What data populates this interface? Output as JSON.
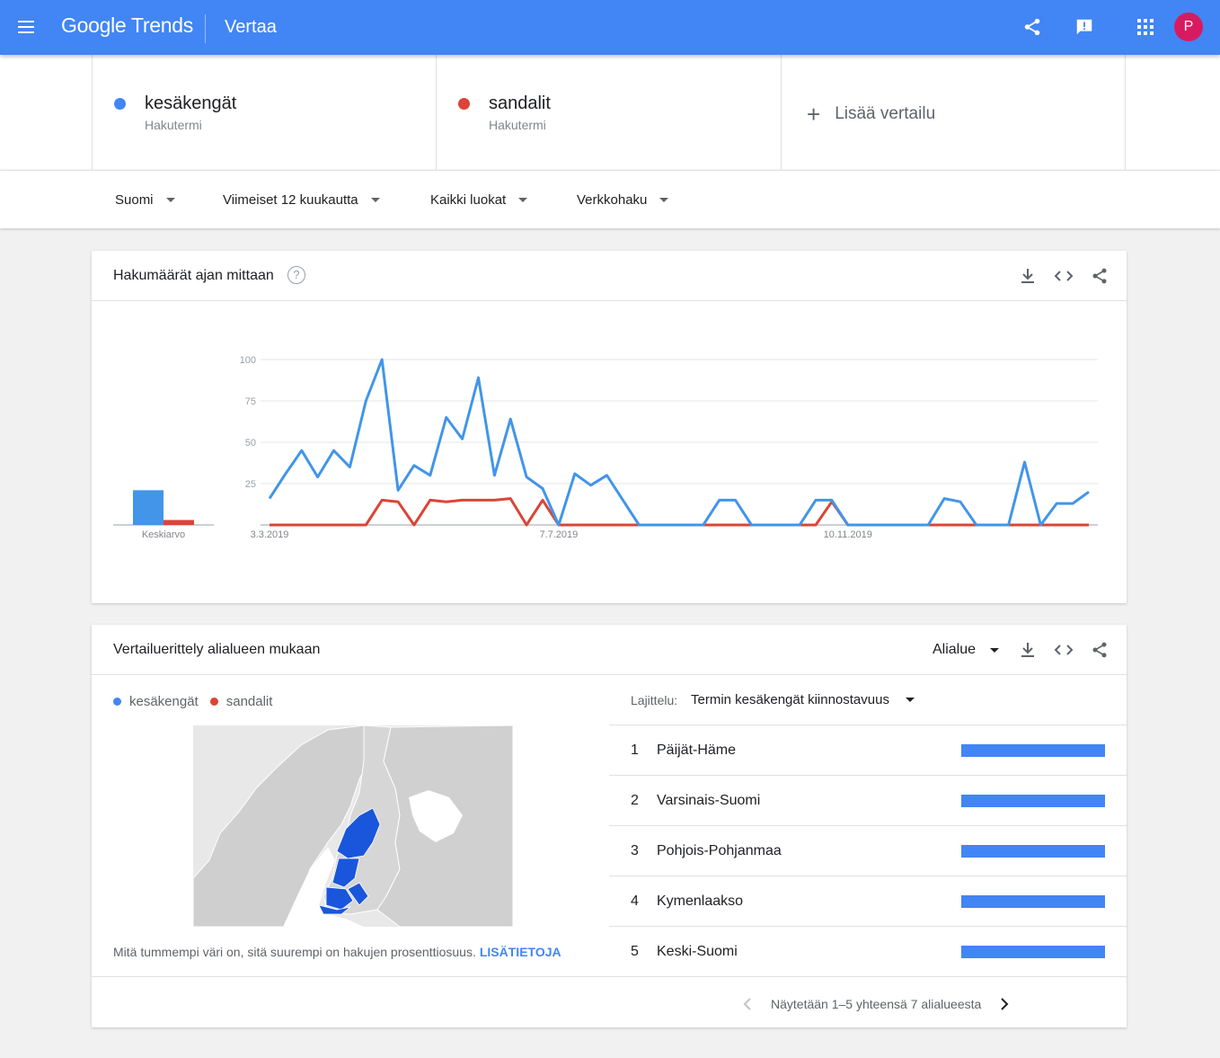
{
  "app": {
    "logo": "Google Trends",
    "page_title": "Vertaa",
    "avatar_letter": "P"
  },
  "terms": [
    {
      "name": "kesäkengät",
      "type": "Hakutermi",
      "color": "#4285f4"
    },
    {
      "name": "sandalit",
      "type": "Hakutermi",
      "color": "#db4437"
    }
  ],
  "add_comparison": {
    "icon": "+",
    "label": "Lisää vertailu"
  },
  "filters": {
    "region": "Suomi",
    "time": "Viimeiset 12 kuukautta",
    "category": "Kaikki luokat",
    "search_type": "Verkkohaku"
  },
  "interest_over_time": {
    "title": "Hakumäärät ajan mittaan",
    "help_icon": "?",
    "average_label": "Keskiarvo"
  },
  "chart_data": {
    "type": "line",
    "x_tick_labels": [
      "3.3.2019",
      "7.7.2019",
      "10.11.2019"
    ],
    "y_ticks": [
      25,
      50,
      75,
      100
    ],
    "ylim": [
      0,
      100
    ],
    "grid": true,
    "series": [
      {
        "name": "kesäkengät",
        "color": "#4285f4",
        "average": 21,
        "values": [
          16,
          31,
          45,
          29,
          45,
          35,
          75,
          100,
          21,
          36,
          30,
          65,
          52,
          89,
          30,
          64,
          29,
          22,
          0,
          31,
          24,
          30,
          15,
          0,
          0,
          0,
          0,
          0,
          15,
          15,
          0,
          0,
          0,
          0,
          15,
          15,
          0,
          0,
          0,
          0,
          0,
          0,
          16,
          14,
          0,
          0,
          0,
          38,
          0,
          13,
          13,
          20
        ]
      },
      {
        "name": "sandalit",
        "color": "#db4437",
        "average": 3,
        "values": [
          0,
          0,
          0,
          0,
          0,
          0,
          0,
          15,
          14,
          0,
          15,
          14,
          15,
          15,
          15,
          16,
          0,
          15,
          0,
          0,
          0,
          0,
          0,
          0,
          0,
          0,
          0,
          0,
          0,
          0,
          0,
          0,
          0,
          0,
          0,
          14,
          0,
          0,
          0,
          0,
          0,
          0,
          0,
          0,
          0,
          0,
          0,
          0,
          0,
          0,
          0,
          0
        ]
      }
    ]
  },
  "by_region": {
    "title": "Vertailuerittely alialueen mukaan",
    "resolution": "Alialue",
    "map_note": "Mitä tummempi väri on, sitä suurempi on hakujen prosenttiosuus.",
    "map_link": "LISÄTIETOJA",
    "sort_label": "Lajittelu:",
    "sort_value": "Termin kesäkengät kiinnostavuus",
    "rows": [
      {
        "rank": "1",
        "name": "Päijät-Häme",
        "share": 100
      },
      {
        "rank": "2",
        "name": "Varsinais-Suomi",
        "share": 100
      },
      {
        "rank": "3",
        "name": "Pohjois-Pohjanmaa",
        "share": 100
      },
      {
        "rank": "4",
        "name": "Kymenlaakso",
        "share": 100
      },
      {
        "rank": "5",
        "name": "Keski-Suomi",
        "share": 100
      }
    ],
    "pager_text": "Näytetään 1–5 yhteensä 7 alialueesta"
  }
}
